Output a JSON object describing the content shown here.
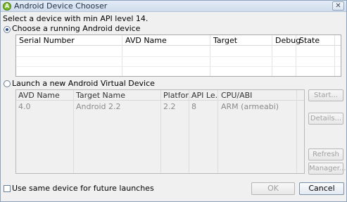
{
  "window": {
    "title": "Android Device Chooser",
    "close_glyph": "✕"
  },
  "instruction": "Select a device with min API level 14.",
  "running": {
    "radio_label": "Choose a running Android device",
    "selected": true,
    "columns": [
      "Serial Number",
      "AVD Name",
      "Target",
      "Debug",
      "State"
    ],
    "rows": []
  },
  "launch": {
    "radio_label": "Launch a new Android Virtual Device",
    "selected": false,
    "columns": [
      "AVD Name",
      "Target Name",
      "Platfor...",
      "API Le...",
      "CPU/ABI"
    ],
    "rows": [
      {
        "avd_name": "4.0",
        "target_name": "Android 2.2",
        "platform": "2.2",
        "api_level": "8",
        "cpu_abi": "ARM (armeabi)"
      }
    ],
    "buttons": {
      "start": "Start...",
      "details": "Details...",
      "refresh": "Refresh",
      "manager": "Manager..."
    }
  },
  "footer": {
    "same_device_label": "Use same device for future launches",
    "same_device_checked": false,
    "ok": "OK",
    "cancel": "Cancel"
  }
}
